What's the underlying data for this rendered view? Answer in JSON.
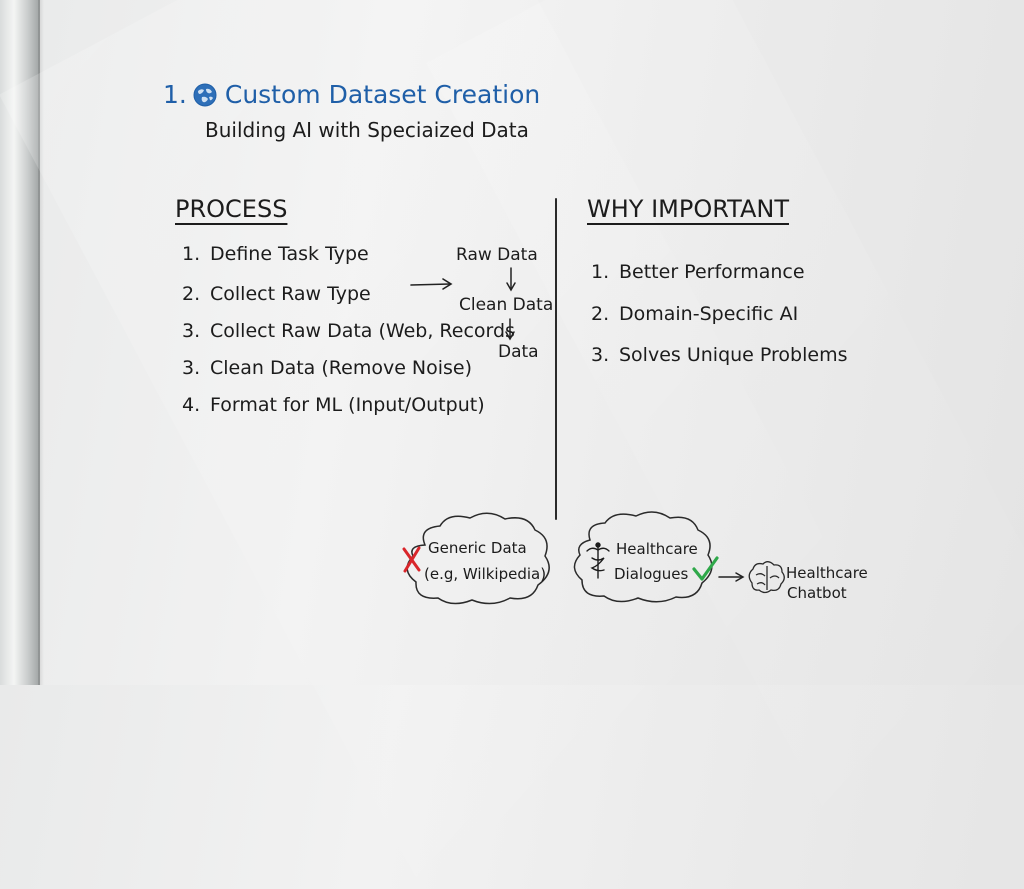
{
  "header": {
    "number": "1.",
    "title": "Custom Dataset Creation",
    "subtitle": "Building AI with Speciaized Data"
  },
  "process": {
    "heading": "PROCESS",
    "steps": [
      {
        "num": "1.",
        "text": "Define Task Type"
      },
      {
        "num": "2.",
        "text": "Collect Raw Type"
      },
      {
        "num": "3.",
        "text": "Collect Raw Data (Web, Records"
      },
      {
        "num": "3.",
        "text": "Clean Data (Remove Noise)"
      },
      {
        "num": "4.",
        "text": "Format for ML (Input/Output)"
      }
    ],
    "flow": [
      "Raw Data",
      "Clean Data",
      "Data"
    ]
  },
  "why": {
    "heading": "WHY IMPORTANT",
    "items": [
      {
        "num": "1.",
        "text": "Better Performance"
      },
      {
        "num": "2.",
        "text": "Domain-Specific AI"
      },
      {
        "num": "3.",
        "text": "Solves Unique Problems"
      }
    ]
  },
  "comparison": {
    "generic": {
      "line1": "Generic Data",
      "line2": "(e.g, Wilkipedia)"
    },
    "healthcare": {
      "line1": "Healthcare",
      "line2": "Dialogues"
    },
    "result": {
      "line1": "Healthcare",
      "line2": "Chatbot"
    }
  },
  "colors": {
    "title": "#1f5fa8",
    "ink": "#1c1c1c",
    "cross": "#d9262b",
    "check": "#2fa84a"
  },
  "icons": [
    "globe-icon",
    "cross-icon",
    "caduceus-icon",
    "check-icon",
    "brain-icon",
    "arrow-right-icon",
    "arrow-down-icon"
  ]
}
